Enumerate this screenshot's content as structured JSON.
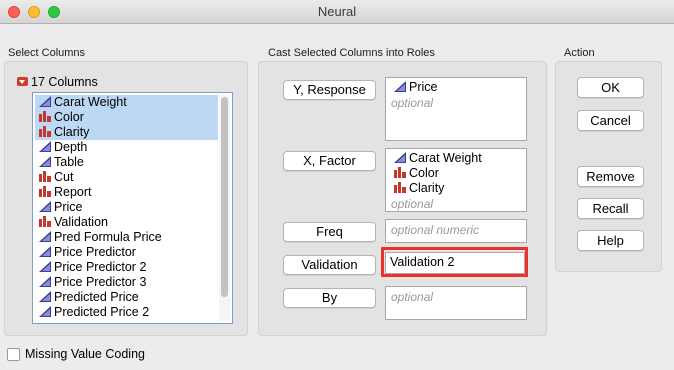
{
  "window": {
    "title": "Neural"
  },
  "select_columns": {
    "heading": "Select Columns",
    "count_label": "17 Columns",
    "items": [
      {
        "label": "Carat Weight",
        "icon": "continuous-icon",
        "selected": true
      },
      {
        "label": "Color",
        "icon": "nominal-icon",
        "selected": true
      },
      {
        "label": "Clarity",
        "icon": "nominal-icon",
        "selected": true
      },
      {
        "label": "Depth",
        "icon": "continuous-icon",
        "selected": false
      },
      {
        "label": "Table",
        "icon": "continuous-icon",
        "selected": false
      },
      {
        "label": "Cut",
        "icon": "nominal-icon",
        "selected": false
      },
      {
        "label": "Report",
        "icon": "nominal-icon",
        "selected": false
      },
      {
        "label": "Price",
        "icon": "continuous-icon",
        "selected": false
      },
      {
        "label": "Validation",
        "icon": "nominal-icon",
        "selected": false
      },
      {
        "label": "Pred Formula Price",
        "icon": "continuous-icon",
        "selected": false
      },
      {
        "label": "Price Predictor",
        "icon": "continuous-icon",
        "selected": false
      },
      {
        "label": "Price Predictor 2",
        "icon": "continuous-icon",
        "selected": false
      },
      {
        "label": "Price Predictor 3",
        "icon": "continuous-icon",
        "selected": false
      },
      {
        "label": "Predicted Price",
        "icon": "continuous-icon",
        "selected": false
      },
      {
        "label": "Predicted Price 2",
        "icon": "continuous-icon",
        "selected": false
      }
    ]
  },
  "cast_roles": {
    "heading": "Cast Selected Columns into Roles",
    "roles": {
      "y_response": {
        "button": "Y, Response",
        "items": [
          "Price"
        ],
        "optional": "optional"
      },
      "x_factor": {
        "button": "X, Factor",
        "items": [
          "Carat Weight",
          "Color",
          "Clarity"
        ],
        "optional": "optional"
      },
      "freq": {
        "button": "Freq",
        "optional": "optional numeric"
      },
      "validation": {
        "button": "Validation",
        "value": "Validation 2"
      },
      "by": {
        "button": "By",
        "optional": "optional"
      }
    }
  },
  "action": {
    "heading": "Action",
    "ok": "OK",
    "cancel": "Cancel",
    "remove": "Remove",
    "recall": "Recall",
    "help": "Help"
  },
  "footer": {
    "missing_value_coding": "Missing Value Coding"
  },
  "colors": {
    "highlight": "#e8322a",
    "selection": "#bcd8f3",
    "accent": "#d23a2b"
  }
}
